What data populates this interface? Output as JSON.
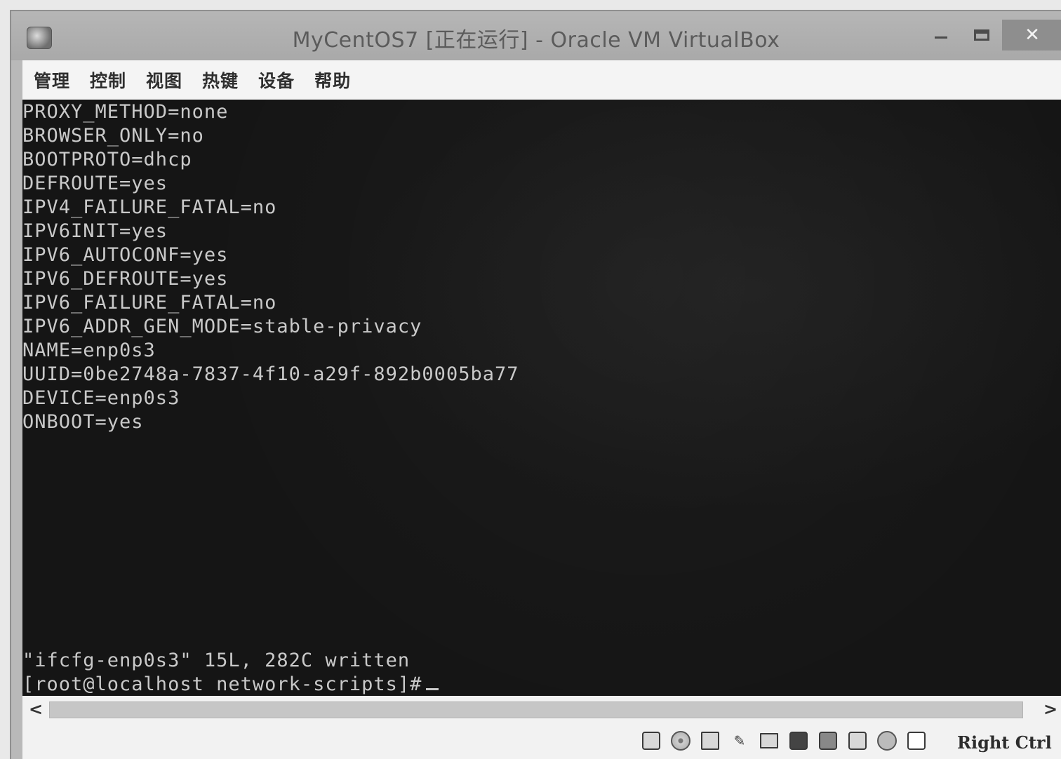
{
  "window": {
    "title": "MyCentOS7 [正在运行] - Oracle VM VirtualBox",
    "minimize_glyph": "—",
    "close_glyph": "✕"
  },
  "menu": [
    "管理",
    "控制",
    "视图",
    "热键",
    "设备",
    "帮助"
  ],
  "terminal": {
    "lines": [
      "PROXY_METHOD=none",
      "BROWSER_ONLY=no",
      "BOOTPROTO=dhcp",
      "DEFROUTE=yes",
      "IPV4_FAILURE_FATAL=no",
      "IPV6INIT=yes",
      "IPV6_AUTOCONF=yes",
      "IPV6_DEFROUTE=yes",
      "IPV6_FAILURE_FATAL=no",
      "IPV6_ADDR_GEN_MODE=stable-privacy",
      "NAME=enp0s3",
      "UUID=0be2748a-7837-4f10-a29f-892b0005ba77",
      "DEVICE=enp0s3",
      "ONBOOT=yes"
    ],
    "status_line": "\"ifcfg-enp0s3\" 15L, 282C written",
    "prompt": "[root@localhost network-scripts]#"
  },
  "scrollbar": {
    "left_arrow": "<",
    "right_arrow": ">"
  },
  "statusbar": {
    "icons": [
      "hard-disk-icon",
      "optical-drive-icon",
      "network-icon",
      "usb-icon",
      "shared-folders-icon",
      "display-icon",
      "video-capture-icon",
      "recording-icon",
      "cpu-icon",
      "mouse-integration-icon"
    ],
    "host_key": "Right Ctrl"
  }
}
